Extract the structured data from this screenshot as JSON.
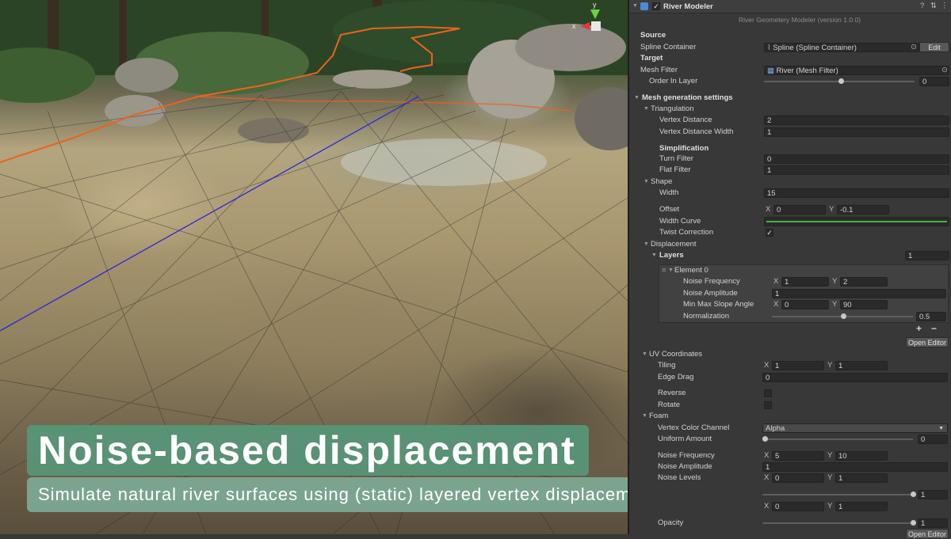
{
  "overlay": {
    "headline": "Noise-based displacement",
    "subline": "Simulate natural river surfaces using (static) layered vertex displacement"
  },
  "gizmo": {
    "y_label": "y",
    "x_label": "x"
  },
  "inspector": {
    "component_title": "River Modeler",
    "subtitle": "River Geometery Modeler (version 1.0.0)",
    "source_label": "Source",
    "spline_container_label": "Spline Container",
    "spline_container_value": "Spline (Spline Container)",
    "edit_button": "Edit",
    "target_label": "Target",
    "mesh_filter_label": "Mesh Filter",
    "mesh_filter_value": "River (Mesh Filter)",
    "order_in_layer_label": "Order In Layer",
    "order_in_layer_value": "0",
    "mesh_generation_label": "Mesh generation settings",
    "triangulation_label": "Triangulation",
    "vertex_distance_label": "Vertex Distance",
    "vertex_distance_value": "2",
    "vertex_distance_width_label": "Vertex Distance Width",
    "vertex_distance_width_value": "1",
    "simplification_label": "Simplification",
    "turn_filter_label": "Turn Filter",
    "turn_filter_value": "0",
    "flat_filter_label": "Flat Filter",
    "flat_filter_value": "1",
    "shape_label": "Shape",
    "width_label": "Width",
    "width_value": "15",
    "offset_label": "Offset",
    "offset_x": "0",
    "offset_y": "-0.1",
    "width_curve_label": "Width Curve",
    "twist_correction_label": "Twist Correction",
    "twist_correction_checked": true,
    "displacement_label": "Displacement",
    "layers_label": "Layers",
    "layers_count": "1",
    "element0_label": "Element 0",
    "noise_frequency_label": "Noise Frequency",
    "noise_frequency_x": "1",
    "noise_frequency_y": "2",
    "noise_amplitude_label": "Noise Amplitude",
    "noise_amplitude_value": "1",
    "min_max_slope_label": "Min Max Slope Angle",
    "min_max_slope_x": "0",
    "min_max_slope_y": "90",
    "normalization_label": "Normalization",
    "normalization_value": "0.5",
    "plus_button": "+",
    "minus_button": "−",
    "open_editor_button": "Open Editor",
    "uv_label": "UV Coordinates",
    "tiling_label": "Tiling",
    "tiling_x": "1",
    "tiling_y": "1",
    "edge_drag_label": "Edge Drag",
    "edge_drag_value": "0",
    "reverse_label": "Reverse",
    "rotate_label": "Rotate",
    "foam_label": "Foam",
    "vertex_color_channel_label": "Vertex Color Channel",
    "vertex_color_channel_value": "Alpha",
    "uniform_amount_label": "Uniform Amount",
    "uniform_amount_value": "0",
    "foam_noise_frequency_label": "Noise Frequency",
    "foam_noise_frequency_x": "5",
    "foam_noise_frequency_y": "10",
    "foam_noise_amplitude_label": "Noise Amplitude",
    "foam_noise_amplitude_value": "1",
    "noise_levels_label": "Noise Levels",
    "noise_levels_x": "0",
    "noise_levels_y": "1",
    "foam_slider_value": "1",
    "foam_vector_x": "0",
    "foam_vector_y": "1",
    "opacity_label": "Opacity",
    "opacity_value": "1",
    "open_editor_button_2": "Open Editor",
    "axis_x": "X",
    "axis_y": "Y"
  },
  "colors": {
    "caption_primary": "#5a967a",
    "caption_secondary": "#7daa96",
    "spline_outline": "#e8641e",
    "spline_center": "#2a2ad8",
    "width_curve": "#3fb83f",
    "gizmo_y": "#6ad43a",
    "gizmo_x": "#e03a3a"
  }
}
